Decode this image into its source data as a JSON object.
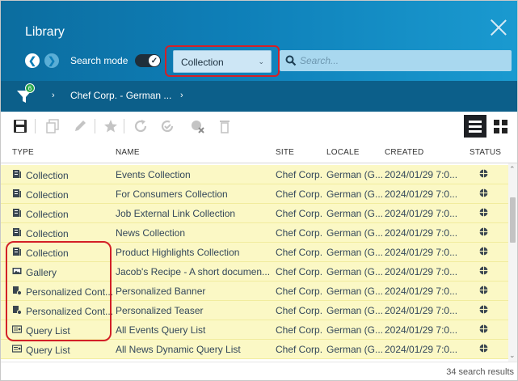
{
  "window": {
    "title": "Library"
  },
  "search_bar": {
    "search_mode_label": "Search mode",
    "type_selected": "Collection",
    "search_placeholder": "Search..."
  },
  "breadcrumb": {
    "filter_count": "6",
    "site": "Chef Corp. - German ..."
  },
  "table": {
    "columns": {
      "type": "TYPE",
      "name": "NAME",
      "site": "SITE",
      "locale": "LOCALE",
      "created": "CREATED",
      "status": "STATUS"
    },
    "rows": [
      {
        "type": "Collection",
        "type_icon": "collection-icon",
        "name": "Events Collection",
        "site": "Chef Corp.",
        "locale": "German (G...",
        "created": "2024/01/29 7:0..."
      },
      {
        "type": "Collection",
        "type_icon": "collection-icon",
        "name": "For Consumers Collection",
        "site": "Chef Corp.",
        "locale": "German (G...",
        "created": "2024/01/29 7:0..."
      },
      {
        "type": "Collection",
        "type_icon": "collection-icon",
        "name": "Job External Link Collection",
        "site": "Chef Corp.",
        "locale": "German (G...",
        "created": "2024/01/29 7:0..."
      },
      {
        "type": "Collection",
        "type_icon": "collection-icon",
        "name": "News Collection",
        "site": "Chef Corp.",
        "locale": "German (G...",
        "created": "2024/01/29 7:0..."
      },
      {
        "type": "Collection",
        "type_icon": "collection-icon",
        "name": "Product Highlights Collection",
        "site": "Chef Corp.",
        "locale": "German (G...",
        "created": "2024/01/29 7:0..."
      },
      {
        "type": "Gallery",
        "type_icon": "gallery-icon",
        "name": "Jacob's Recipe - A short documen...",
        "site": "Chef Corp.",
        "locale": "German (G...",
        "created": "2024/01/29 7:0..."
      },
      {
        "type": "Personalized Cont...",
        "type_icon": "personalized-content-icon",
        "name": "Personalized Banner",
        "site": "Chef Corp.",
        "locale": "German (G...",
        "created": "2024/01/29 7:0..."
      },
      {
        "type": "Personalized Cont...",
        "type_icon": "personalized-content-icon",
        "name": "Personalized Teaser",
        "site": "Chef Corp.",
        "locale": "German (G...",
        "created": "2024/01/29 7:0..."
      },
      {
        "type": "Query List",
        "type_icon": "query-list-icon",
        "name": "All Events Query List",
        "site": "Chef Corp.",
        "locale": "German (G...",
        "created": "2024/01/29 7:0..."
      },
      {
        "type": "Query List",
        "type_icon": "query-list-icon",
        "name": "All News Dynamic Query List",
        "site": "Chef Corp.",
        "locale": "German (G...",
        "created": "2024/01/29 7:0..."
      }
    ]
  },
  "footer": {
    "results": "34 search results"
  },
  "colors": {
    "header": "#0e7fb8",
    "breadcrumb_bar": "#0c5f8a",
    "row_highlight": "#fbf8c5",
    "annotation": "#d32027"
  }
}
